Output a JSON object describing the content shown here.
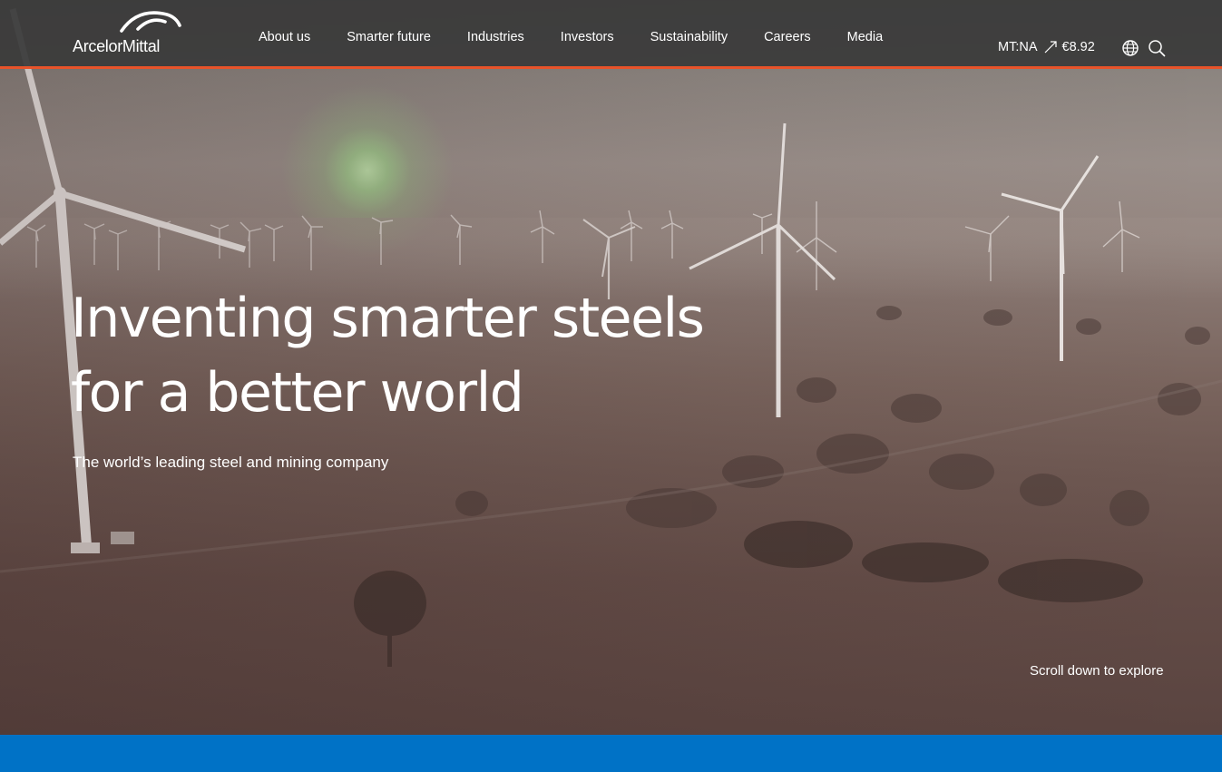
{
  "brand": {
    "name": "ArcelorMittal",
    "accent_color": "#e8532a",
    "band_color": "#0072c6"
  },
  "nav": {
    "items": [
      {
        "label": "About us"
      },
      {
        "label": "Smarter future"
      },
      {
        "label": "Industries"
      },
      {
        "label": "Investors"
      },
      {
        "label": "Sustainability"
      },
      {
        "label": "Careers"
      },
      {
        "label": "Media"
      }
    ]
  },
  "stock": {
    "ticker": "MT:NA",
    "trend_icon": "arrow-up-right-icon",
    "price": "€8.92"
  },
  "header_icons": {
    "language": "globe-icon",
    "search": "search-icon"
  },
  "hero": {
    "headline_line1": "Inventing smarter steels",
    "headline_line2": "for a better world",
    "subtitle": "The world’s leading steel and mining company",
    "scroll_hint": "Scroll down to explore"
  }
}
